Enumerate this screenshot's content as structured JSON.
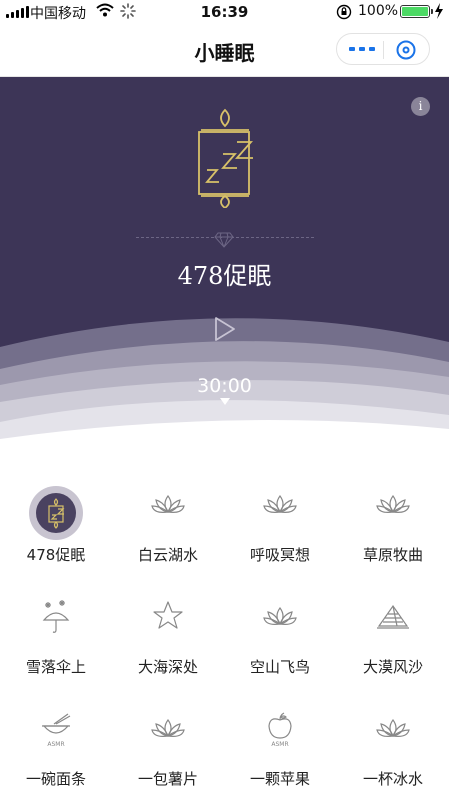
{
  "status_bar": {
    "carrier": "中国移动",
    "time": "16:39",
    "battery": "100%"
  },
  "nav": {
    "title": "小睡眠"
  },
  "hero": {
    "mode_title": "478促眠",
    "timer": "30:00",
    "info_label": "i"
  },
  "grid": {
    "items": [
      {
        "label": "478促眠",
        "icon": "candle-zzz-icon",
        "active": true
      },
      {
        "label": "白云湖水",
        "icon": "lotus-icon"
      },
      {
        "label": "呼吸冥想",
        "icon": "lotus-icon"
      },
      {
        "label": "草原牧曲",
        "icon": "lotus-icon"
      },
      {
        "label": "雪落伞上",
        "icon": "snow-umbrella-icon"
      },
      {
        "label": "大海深处",
        "icon": "starfish-icon"
      },
      {
        "label": "空山飞鸟",
        "icon": "lotus-icon"
      },
      {
        "label": "大漠风沙",
        "icon": "pyramid-icon"
      },
      {
        "label": "一碗面条",
        "icon": "noodle-bowl-icon",
        "badge": "ASMR"
      },
      {
        "label": "一包薯片",
        "icon": "lotus-icon"
      },
      {
        "label": "一颗苹果",
        "icon": "apple-icon",
        "badge": "ASMR"
      },
      {
        "label": "一杯冰水",
        "icon": "lotus-icon"
      }
    ]
  },
  "colors": {
    "hero_bg": "#3d3557",
    "gold": "#d8c169",
    "accent_blue": "#1a73e8",
    "battery": "#4cd964"
  }
}
